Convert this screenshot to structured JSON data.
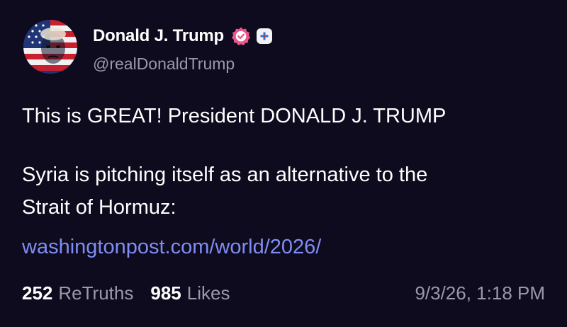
{
  "author": {
    "display_name": "Donald J. Trump",
    "handle": "@realDonaldTrump",
    "verified": true,
    "avatar_icon": "flag-portrait-avatar",
    "badge_icon": "plus-icon"
  },
  "post": {
    "line1": "This is GREAT! President DONALD J. TRUMP",
    "line2": "Syria is pitching itself as an alternative to the",
    "line3": "Strait of Hormuz:",
    "link_text": "washingtonpost.com/world/2026/"
  },
  "stats": {
    "retruths_count": "252",
    "retruths_label": "ReTruths",
    "likes_count": "985",
    "likes_label": "Likes",
    "timestamp": "9/3/26, 1:18 PM"
  },
  "colors": {
    "background": "#0f0b1f",
    "link": "#7f8df2",
    "muted_text": "#9a98aa",
    "verified_badge": "#e8568c"
  }
}
